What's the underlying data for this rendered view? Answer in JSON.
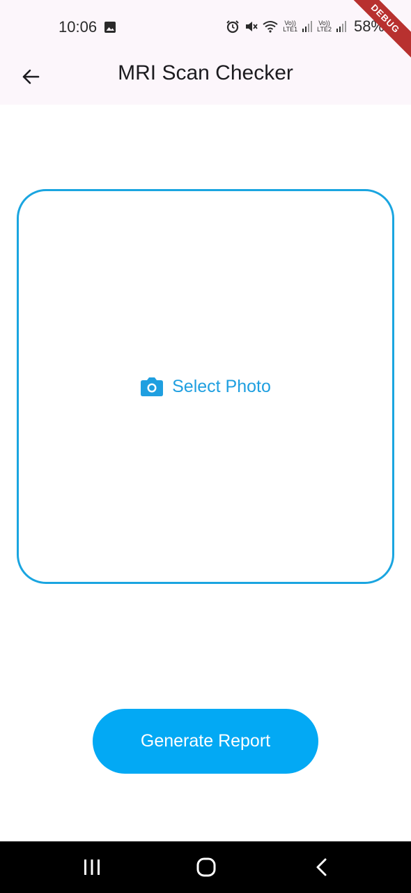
{
  "status_bar": {
    "time": "10:06",
    "lte1": "LTE1",
    "lte2": "LTE2",
    "volte1": "Vo))",
    "volte2": "Vo))",
    "battery": "58%",
    "icons": [
      "gallery-icon",
      "alarm-icon",
      "mute-icon",
      "wifi-icon",
      "signal-icon",
      "battery-icon"
    ]
  },
  "debug_banner": "DEBUG",
  "app_bar": {
    "title": "MRI Scan Checker",
    "back_icon": "arrow-back-icon"
  },
  "photo_picker": {
    "label": "Select Photo",
    "icon": "camera-icon",
    "border_color": "#1aa5e0"
  },
  "generate_button": {
    "label": "Generate Report",
    "color": "#03a9f4"
  },
  "nav_bar": {
    "icons": [
      "recent-apps-icon",
      "home-icon",
      "back-icon"
    ]
  }
}
